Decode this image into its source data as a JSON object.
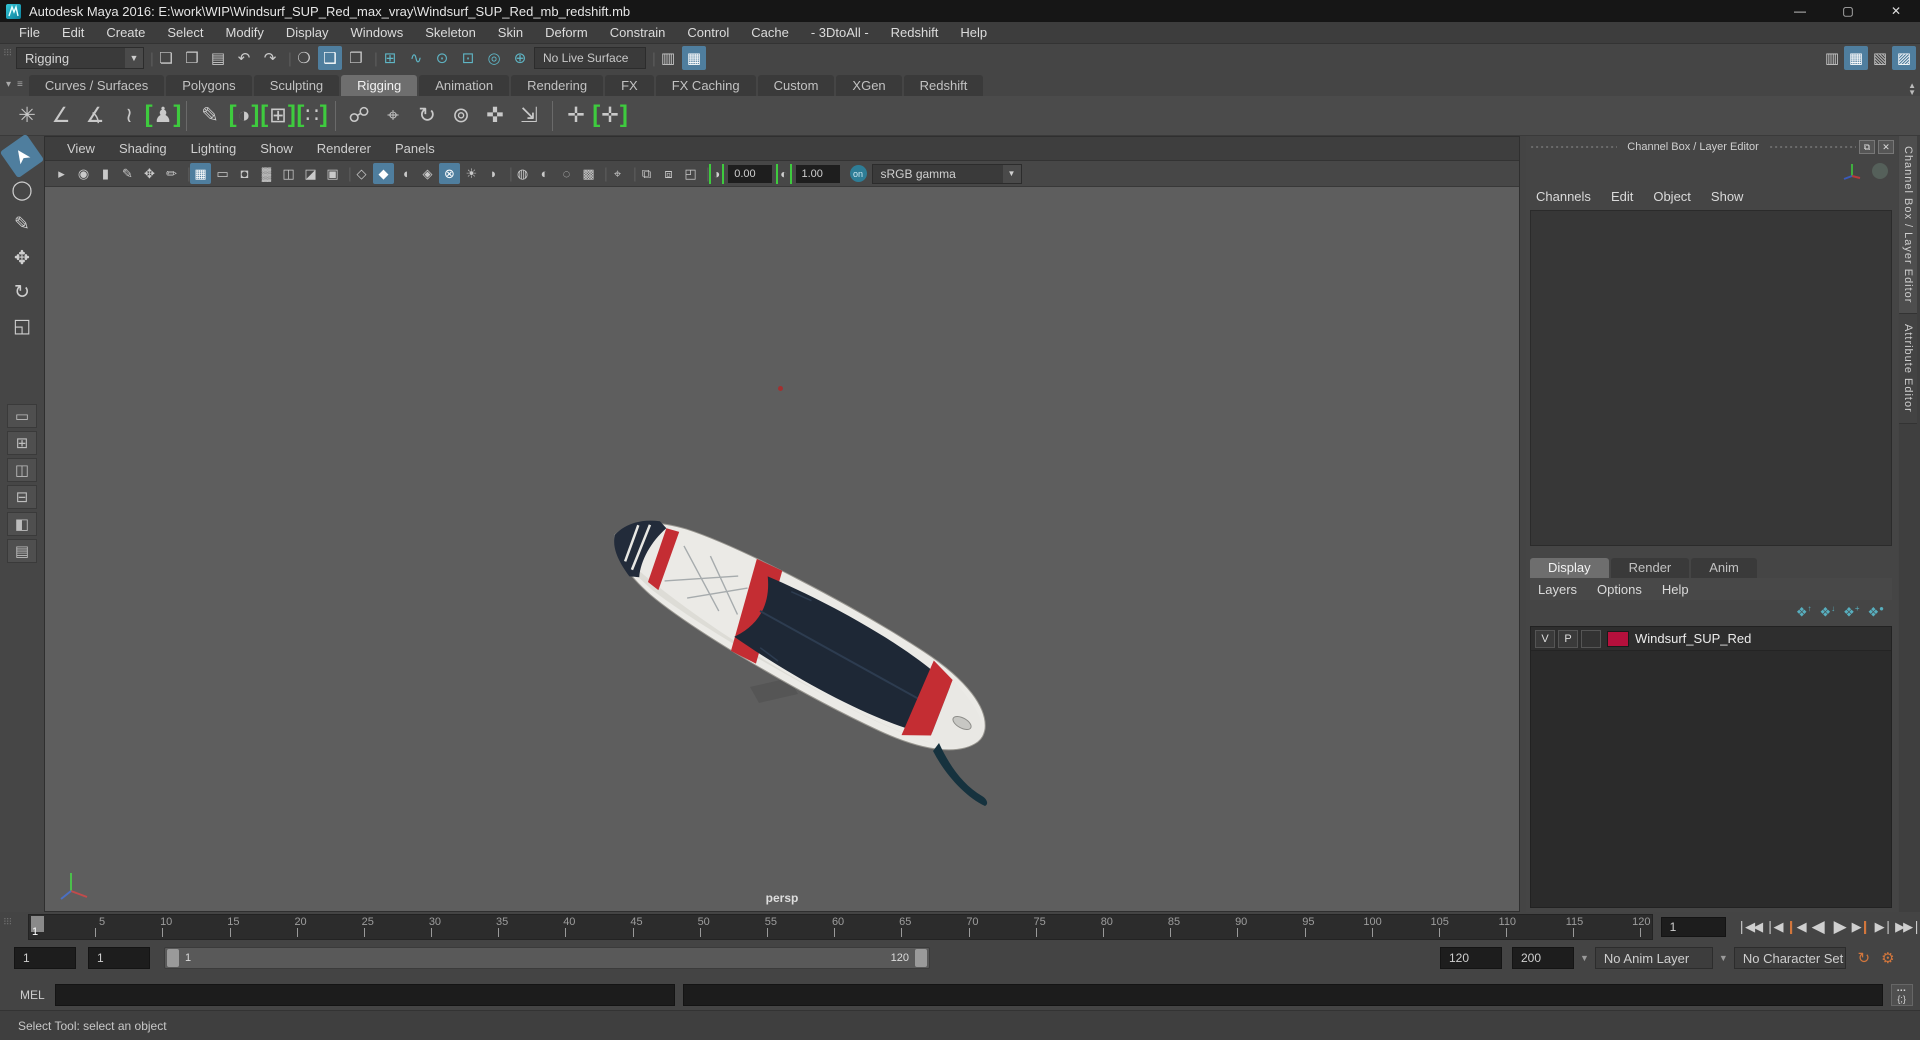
{
  "window": {
    "title": "Autodesk Maya 2016: E:\\work\\WIP\\Windsurf_SUP_Red_max_vray\\Windsurf_SUP_Red_mb_redshift.mb",
    "minimize": "—",
    "maximize": "▢",
    "close": "✕"
  },
  "menubar": {
    "items": [
      "File",
      "Edit",
      "Create",
      "Select",
      "Modify",
      "Display",
      "Windows",
      "Skeleton",
      "Skin",
      "Deform",
      "Constrain",
      "Control",
      "Cache",
      "- 3DtoAll -",
      "Redshift",
      "Help"
    ]
  },
  "statusline": {
    "mode": "Rigging",
    "live_surface": "No Live Surface"
  },
  "shelf": {
    "tabs": [
      "Curves / Surfaces",
      "Polygons",
      "Sculpting",
      "Rigging",
      "Animation",
      "Rendering",
      "FX",
      "FX Caching",
      "Custom",
      "XGen",
      "Redshift"
    ],
    "active_tab": "Rigging"
  },
  "viewport": {
    "menu": [
      "View",
      "Shading",
      "Lighting",
      "Show",
      "Renderer",
      "Panels"
    ],
    "exposure": "0.00",
    "gamma": "1.00",
    "view_transform": "sRGB gamma",
    "camera_label": "persp"
  },
  "channel_box": {
    "title": "Channel Box / Layer Editor",
    "menu": [
      "Channels",
      "Edit",
      "Object",
      "Show"
    ]
  },
  "layer_editor": {
    "tabs": [
      "Display",
      "Render",
      "Anim"
    ],
    "active_tab": "Display",
    "menu": [
      "Layers",
      "Options",
      "Help"
    ],
    "layer": {
      "visible": "V",
      "playback": "P",
      "name": "Windsurf_SUP_Red",
      "color": "#b5103c"
    }
  },
  "side_tabs": {
    "channel_box": "Channel Box / Layer Editor",
    "attribute_editor": "Attribute Editor"
  },
  "timeline": {
    "tick_labels": [
      "5",
      "10",
      "15",
      "20",
      "25",
      "30",
      "35",
      "40",
      "45",
      "50",
      "55",
      "60",
      "65",
      "70",
      "75",
      "80",
      "85",
      "90",
      "95",
      "100",
      "105",
      "110",
      "115",
      "120"
    ],
    "current_frame": "1",
    "anim_start": "1",
    "playback_start": "1",
    "playback_end": "120",
    "anim_end": "200",
    "range_start_label": "1",
    "range_end_label": "120",
    "anim_layer": "No Anim Layer",
    "character_set": "No Character Set",
    "playback_buttons": {
      "go_start": "❘◀◀",
      "step_back": "❘◀",
      "prev_key": "◀",
      "play_back": "◀",
      "play": "▶",
      "next_key": "▶",
      "step_fwd": "▶❘",
      "go_end": "▶▶❘",
      "key_bar": "❙"
    }
  },
  "command_line": {
    "label": "MEL",
    "script_editor_glyph": "{;}",
    "help_text": "Select Tool: select an object"
  },
  "colors": {
    "accent_blue": "#4f7e9e",
    "icon_teal": "#5fb6c6",
    "icon_purple": "#b9aede",
    "icon_orange": "#d2763c",
    "layer_swatch": "#b5103c"
  },
  "glyphs": {
    "grip": "⠿⠿",
    "separator": "❘",
    "dropdown_arrow": "▼",
    "new_scene": "❏",
    "open_scene": "❒",
    "save_scene": "▤",
    "undo": "↶",
    "redo": "↷",
    "select_hierarchy": "❍",
    "select_object": "❑",
    "select_component": "❒",
    "snap_grid": "⊞",
    "snap_curve": "∿",
    "snap_point": "⊙",
    "snap_plane": "⊡",
    "make_live": "◎",
    "snap_center": "⊕",
    "construction_history": "▥",
    "render_view": "▦",
    "ipr_render": "▧",
    "render_settings": "▨",
    "select_tool": "➤",
    "lasso_tool": "◯",
    "paint_select_tool": "✎",
    "move_tool": "✥",
    "rotate_tool": "↻",
    "scale_tool": "◱",
    "layout_single": "▭",
    "layout_four": "⊞",
    "layout_two": "◫",
    "layout_stack": "⊟",
    "layout_three": "◧",
    "layout_outliner": "▤",
    "joint_tool": "✳",
    "ik_handle": "∠",
    "ik_spline": "∡",
    "insert_joint": "≀",
    "humanik": "♟",
    "paint_weights": "✎",
    "bind_skin": "◑",
    "lattice": "⊞",
    "cluster": "∷",
    "parent_constraint": "☍",
    "point_constraint": "⌖",
    "orient_constraint": "↻",
    "aim_constraint": "⊚",
    "pole_vector": "✜",
    "scale_constraint": "⇲",
    "locator": "✛",
    "locator_link": "✛",
    "vp_camera": "▸",
    "vp_camera_attrs": "◉",
    "vp_bookmark": "▮",
    "vp_image_plane": "✎",
    "vp_pan_zoom": "✥",
    "vp_grease": "✏",
    "vp_grid": "▦",
    "vp_film_gate": "▭",
    "vp_res_gate": "◘",
    "vp_gate_mask": "▓",
    "vp_field_chart": "◫",
    "vp_safe_action": "◪",
    "vp_safe_title": "▣",
    "vp_wireframe": "◇",
    "vp_shaded": "◆",
    "vp_flat": "◖",
    "vp_bbox": "◈",
    "vp_textured": "⊗",
    "vp_lights": "☀",
    "vp_shadows": "◗",
    "vp_default_light": "◍",
    "vp_ambient": "◐",
    "vp_no_light": "◌",
    "vp_occlusion": "▩",
    "vp_isolate": "⌖",
    "vp_xray": "⧉",
    "vp_xray_joints": "⧈",
    "vp_exposure_panel": "◰",
    "exposure_ic": "◑",
    "contrast_ic": "◐",
    "color_mgmt": "on",
    "cb_restore": "⧉",
    "cb_close": "✕",
    "layer_up": "❖",
    "layer_down": "❖",
    "layer_new": "❖",
    "layer_new_sel": "❖",
    "loop": "↻",
    "anim_prefs": "⚙",
    "shelf_menu": "▾",
    "shelf_list": "≡",
    "scroll_up": "▲",
    "scroll_down": "▼"
  }
}
